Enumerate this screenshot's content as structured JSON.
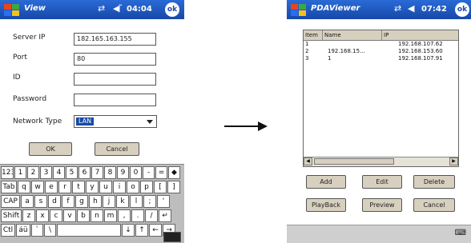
{
  "left": {
    "titlebar": {
      "title": "View",
      "time": "04:04",
      "ok_label": "ok",
      "icons": [
        "windows-flag-icon",
        "connectivity-icon",
        "volume-icon"
      ]
    },
    "fields": [
      {
        "label": "Server IP",
        "value": "182.165.163.155"
      },
      {
        "label": "Port",
        "value": "80"
      },
      {
        "label": "ID",
        "value": ""
      },
      {
        "label": "Password",
        "value": ""
      }
    ],
    "network_type": {
      "label": "Network Type",
      "value": "LAN"
    },
    "buttons": {
      "ok": "OK",
      "cancel": "Cancel"
    },
    "keyboard": {
      "rows": [
        [
          "123",
          "1",
          "2",
          "3",
          "4",
          "5",
          "6",
          "7",
          "8",
          "9",
          "0",
          "-",
          "=",
          "◆"
        ],
        [
          "Tab",
          "q",
          "w",
          "e",
          "r",
          "t",
          "y",
          "u",
          "i",
          "o",
          "p",
          "[",
          "]"
        ],
        [
          "CAP",
          "a",
          "s",
          "d",
          "f",
          "g",
          "h",
          "j",
          "k",
          "l",
          ";",
          "'"
        ],
        [
          "Shift",
          "z",
          "x",
          "c",
          "v",
          "b",
          "n",
          "m",
          ",",
          ".",
          "/",
          "↵"
        ],
        [
          "Ctl",
          "áü",
          "`",
          "\\",
          "",
          "↓",
          "↑",
          "←",
          "→"
        ]
      ]
    }
  },
  "right": {
    "titlebar": {
      "title": "PDAViewer",
      "time": "07:42",
      "ok_label": "ok",
      "icons": [
        "windows-flag-icon",
        "connectivity-icon",
        "volume-icon"
      ]
    },
    "listview": {
      "columns": [
        "Item",
        "Name",
        "IP"
      ],
      "rows": [
        [
          "1",
          "",
          "192.168.107.62"
        ],
        [
          "2",
          "192.168.15...",
          "192.168.153.60"
        ],
        [
          "3",
          "1",
          "192.168.107.91"
        ]
      ]
    },
    "buttons": {
      "add": "Add",
      "edit": "Edit",
      "delete": "Delete",
      "playback": "PlayBack",
      "preview": "Preview",
      "cancel": "Cancel"
    },
    "bottombar": {
      "icon": "sip-keyboard-icon"
    }
  }
}
